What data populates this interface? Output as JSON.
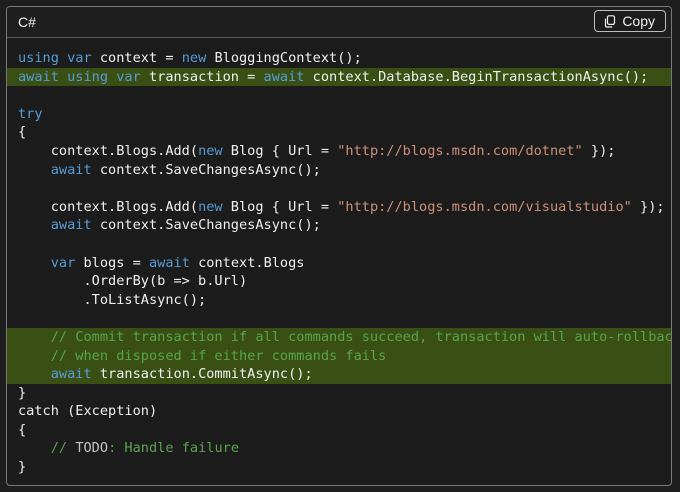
{
  "header": {
    "language": "C#",
    "copy_label": "Copy",
    "copy_icon": "copy-icon"
  },
  "colors": {
    "keyword": "#569cd6",
    "string": "#ce9178",
    "comment": "#57a64a",
    "text": "#f0f0f0",
    "highlight": "#3a4f14"
  },
  "code": {
    "lines": [
      {
        "highlight": false,
        "tokens": [
          {
            "t": "kw",
            "v": "using"
          },
          {
            "t": "",
            "v": " "
          },
          {
            "t": "kw",
            "v": "var"
          },
          {
            "t": "",
            "v": " context = "
          },
          {
            "t": "kw",
            "v": "new"
          },
          {
            "t": "",
            "v": " BloggingContext();"
          }
        ]
      },
      {
        "highlight": true,
        "tokens": [
          {
            "t": "kw",
            "v": "await"
          },
          {
            "t": "",
            "v": " "
          },
          {
            "t": "kw",
            "v": "using"
          },
          {
            "t": "",
            "v": " "
          },
          {
            "t": "kw",
            "v": "var"
          },
          {
            "t": "",
            "v": " transaction = "
          },
          {
            "t": "kw",
            "v": "await"
          },
          {
            "t": "",
            "v": " context.Database.BeginTransactionAsync();"
          }
        ]
      },
      {
        "highlight": false,
        "tokens": []
      },
      {
        "highlight": false,
        "tokens": [
          {
            "t": "kw",
            "v": "try"
          }
        ]
      },
      {
        "highlight": false,
        "tokens": [
          {
            "t": "",
            "v": "{"
          }
        ]
      },
      {
        "highlight": false,
        "tokens": [
          {
            "t": "",
            "v": "    context.Blogs.Add("
          },
          {
            "t": "kw",
            "v": "new"
          },
          {
            "t": "",
            "v": " Blog { Url = "
          },
          {
            "t": "str",
            "v": "\"http://blogs.msdn.com/dotnet\""
          },
          {
            "t": "",
            "v": " });"
          }
        ]
      },
      {
        "highlight": false,
        "tokens": [
          {
            "t": "",
            "v": "    "
          },
          {
            "t": "kw",
            "v": "await"
          },
          {
            "t": "",
            "v": " context.SaveChangesAsync();"
          }
        ]
      },
      {
        "highlight": false,
        "tokens": []
      },
      {
        "highlight": false,
        "tokens": [
          {
            "t": "",
            "v": "    context.Blogs.Add("
          },
          {
            "t": "kw",
            "v": "new"
          },
          {
            "t": "",
            "v": " Blog { Url = "
          },
          {
            "t": "str",
            "v": "\"http://blogs.msdn.com/visualstudio\""
          },
          {
            "t": "",
            "v": " });"
          }
        ]
      },
      {
        "highlight": false,
        "tokens": [
          {
            "t": "",
            "v": "    "
          },
          {
            "t": "kw",
            "v": "await"
          },
          {
            "t": "",
            "v": " context.SaveChangesAsync();"
          }
        ]
      },
      {
        "highlight": false,
        "tokens": []
      },
      {
        "highlight": false,
        "tokens": [
          {
            "t": "",
            "v": "    "
          },
          {
            "t": "kw",
            "v": "var"
          },
          {
            "t": "",
            "v": " blogs = "
          },
          {
            "t": "kw",
            "v": "await"
          },
          {
            "t": "",
            "v": " context.Blogs"
          }
        ]
      },
      {
        "highlight": false,
        "tokens": [
          {
            "t": "",
            "v": "        .OrderBy(b => b.Url)"
          }
        ]
      },
      {
        "highlight": false,
        "tokens": [
          {
            "t": "",
            "v": "        .ToListAsync();"
          }
        ]
      },
      {
        "highlight": false,
        "tokens": []
      },
      {
        "highlight": true,
        "tokens": [
          {
            "t": "",
            "v": "    "
          },
          {
            "t": "cm",
            "v": "// Commit transaction if all commands succeed, transaction will auto-rollback"
          }
        ]
      },
      {
        "highlight": true,
        "tokens": [
          {
            "t": "",
            "v": "    "
          },
          {
            "t": "cm",
            "v": "// when disposed if either commands fails"
          }
        ]
      },
      {
        "highlight": true,
        "tokens": [
          {
            "t": "",
            "v": "    "
          },
          {
            "t": "kw",
            "v": "await"
          },
          {
            "t": "",
            "v": " transaction.CommitAsync();"
          }
        ]
      },
      {
        "highlight": false,
        "tokens": [
          {
            "t": "",
            "v": "}"
          }
        ]
      },
      {
        "highlight": false,
        "tokens": [
          {
            "t": "",
            "v": "catch (Exception)"
          }
        ]
      },
      {
        "highlight": false,
        "tokens": [
          {
            "t": "",
            "v": "{"
          }
        ]
      },
      {
        "highlight": false,
        "tokens": [
          {
            "t": "",
            "v": "    "
          },
          {
            "t": "cm",
            "v": "// "
          },
          {
            "t": "td",
            "v": "TODO"
          },
          {
            "t": "cm",
            "v": ": Handle failure"
          }
        ]
      },
      {
        "highlight": false,
        "tokens": [
          {
            "t": "",
            "v": "}"
          }
        ]
      }
    ]
  }
}
